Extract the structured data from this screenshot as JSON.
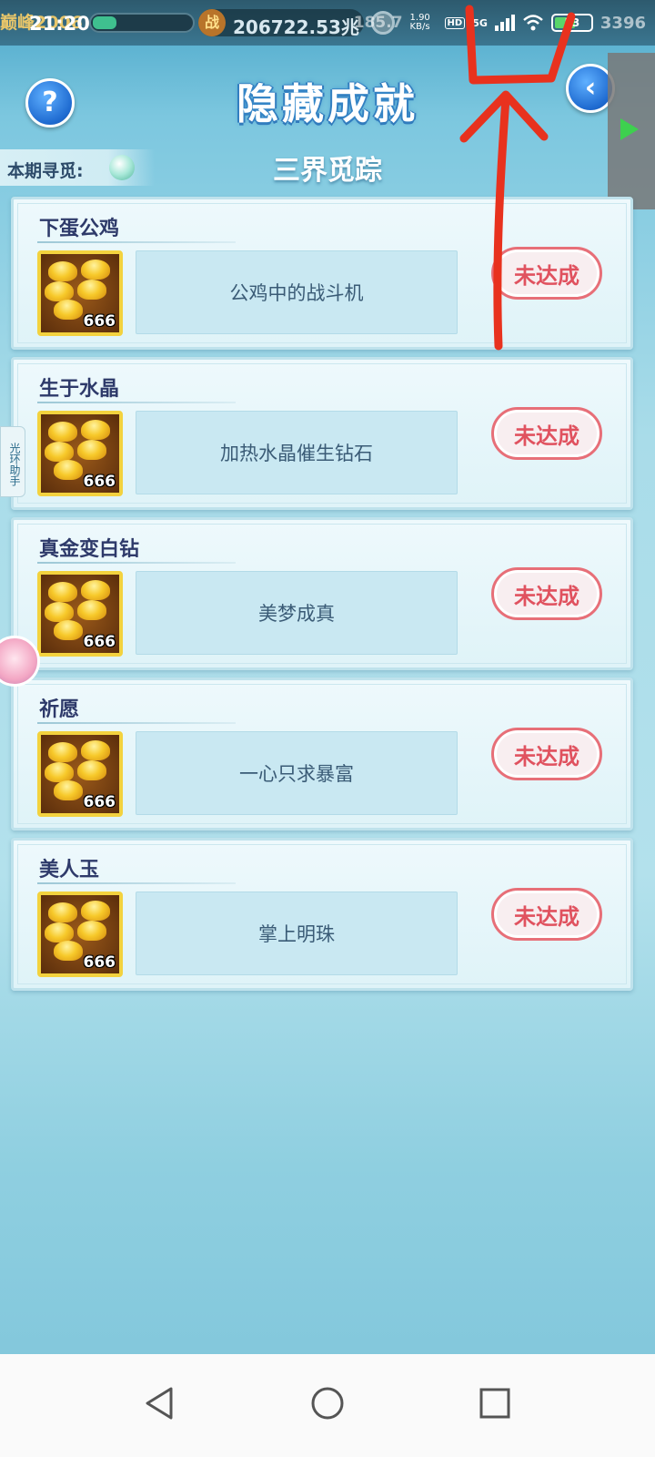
{
  "status_bar": {
    "game_title": "巅峰2006",
    "time": "21:20",
    "power_icon": "战",
    "power_value": "206722.53兆",
    "faded_text": "185.7",
    "net_speed": "1.90 KB/s",
    "hd_label": "HD",
    "network": "5G",
    "battery_level": "53",
    "faded_battery_text": "3396"
  },
  "header": {
    "title": "隐藏成就",
    "help_icon": "help-icon",
    "back_icon": "back-arrow-icon",
    "period_label": "本期寻觅:",
    "subtitle": "三界觅踪"
  },
  "side_helper": {
    "label": "光环助手"
  },
  "achievements": [
    {
      "name": "下蛋公鸡",
      "reward_count": "666",
      "description": "公鸡中的战斗机",
      "status": "未达成"
    },
    {
      "name": "生于水晶",
      "reward_count": "666",
      "description": "加热水晶催生钻石",
      "status": "未达成"
    },
    {
      "name": "真金变白钻",
      "reward_count": "666",
      "description": "美梦成真",
      "status": "未达成"
    },
    {
      "name": "祈愿",
      "reward_count": "666",
      "description": "一心只求暴富",
      "status": "未达成"
    },
    {
      "name": "美人玉",
      "reward_count": "666",
      "description": "掌上明珠",
      "status": "未达成"
    }
  ],
  "nav": {
    "back_icon": "triangle-back-icon",
    "home_icon": "circle-home-icon",
    "recents_icon": "square-recents-icon"
  },
  "colors": {
    "status_red": "#e0525f",
    "title_blue": "#2f77b8",
    "annotation_red": "#e8321e"
  }
}
